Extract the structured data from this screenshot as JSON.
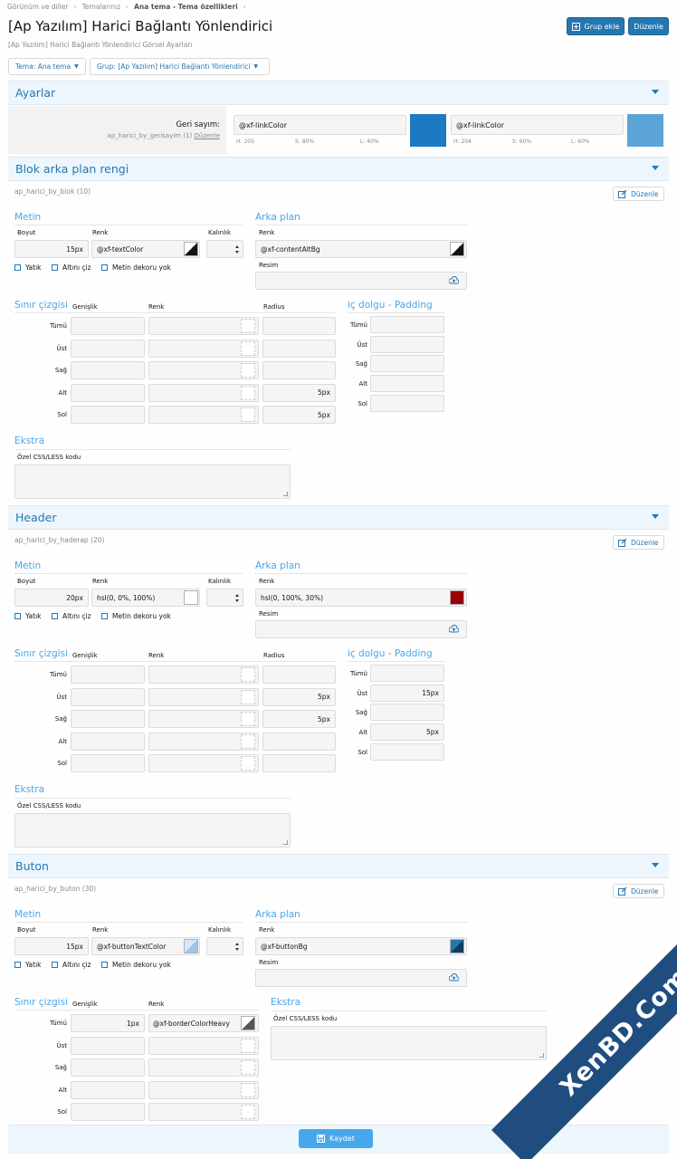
{
  "breadcrumb": [
    "Görünüm ve diller",
    "Temalarınız",
    "Ana tema - Tema özellikleri"
  ],
  "page": {
    "title": "[Ap Yazılım] Harici Bağlantı Yönlendirici",
    "subtitle": "[Ap Yazılım] Harici Bağlantı Yönlendirici Görsel Ayarları"
  },
  "top_buttons": {
    "add_group": "Grup ekle",
    "edit": "Düzenle"
  },
  "filters": {
    "theme": "Tema: Ana tema",
    "group": "Grup: [Ap Yazılım] Harici Bağlantı Yönlendirici"
  },
  "colors": {
    "accent": "#2577b1",
    "link_light": "#47a7eb"
  },
  "ayarlar": {
    "title": "Ayarlar",
    "label": "Geri sayım:",
    "key": "ap_harici_by_gerisayim (1)",
    "edit_link": "Düzenle",
    "colors": [
      {
        "value": "@xf-linkColor",
        "h": "H: 205",
        "s": "S: 80%",
        "l": "L: 40%",
        "swatch": "#1c7ac2"
      },
      {
        "value": "@xf-linkColor",
        "h": "H: 204",
        "s": "S: 60%",
        "l": "L: 60%",
        "swatch": "#5ba4d8"
      }
    ]
  },
  "labels": {
    "metin": "Metin",
    "boyut": "Boyut",
    "renk": "Renk",
    "kalinlik": "Kalınlık",
    "arka_plan": "Arka plan",
    "resim": "Resim",
    "yatik": "Yatık",
    "altini_ciz": "Altını çiz",
    "dekor_yok": "Metin dekoru yok",
    "sinir": "Sınır çizgisi",
    "genislik": "Genişlik",
    "radius": "Radius",
    "padding": "iç dolgu - Padding",
    "sides": [
      "Tümü",
      "Üst",
      "Sağ",
      "Alt",
      "Sol"
    ],
    "ekstra": "Ekstra",
    "css": "Özel CSS/LESS kodu",
    "edit": "Düzenle"
  },
  "blok": {
    "title": "Blok arka plan rengi",
    "key": "ap_harici_by_blok (10)",
    "size": "15px",
    "color": "@xf-textColor",
    "bg": "@xf-contentAltBg",
    "radius": [
      "",
      "",
      "",
      "5px",
      "5px"
    ],
    "padding": [
      "",
      "",
      "",
      "",
      ""
    ]
  },
  "header": {
    "title": "Header",
    "key": "ap_harici_by_haderap (20)",
    "size": "20px",
    "color": "hsl(0, 0%, 100%)",
    "bg": "hsl(0, 100%, 30%)",
    "bg_swatch": "#990000",
    "radius": [
      "",
      "5px",
      "5px",
      "",
      ""
    ],
    "padding": [
      "",
      "15px",
      "",
      "5px",
      ""
    ]
  },
  "buton": {
    "title": "Buton",
    "key": "ap_harici_by_buton (30)",
    "size": "15px",
    "color": "@xf-buttonTextColor",
    "bg": "@xf-buttonBg",
    "border_width": "1px",
    "border_color": "@xf-borderColorHeavy"
  },
  "save": "Kaydet",
  "watermark": "XenBD.Com"
}
